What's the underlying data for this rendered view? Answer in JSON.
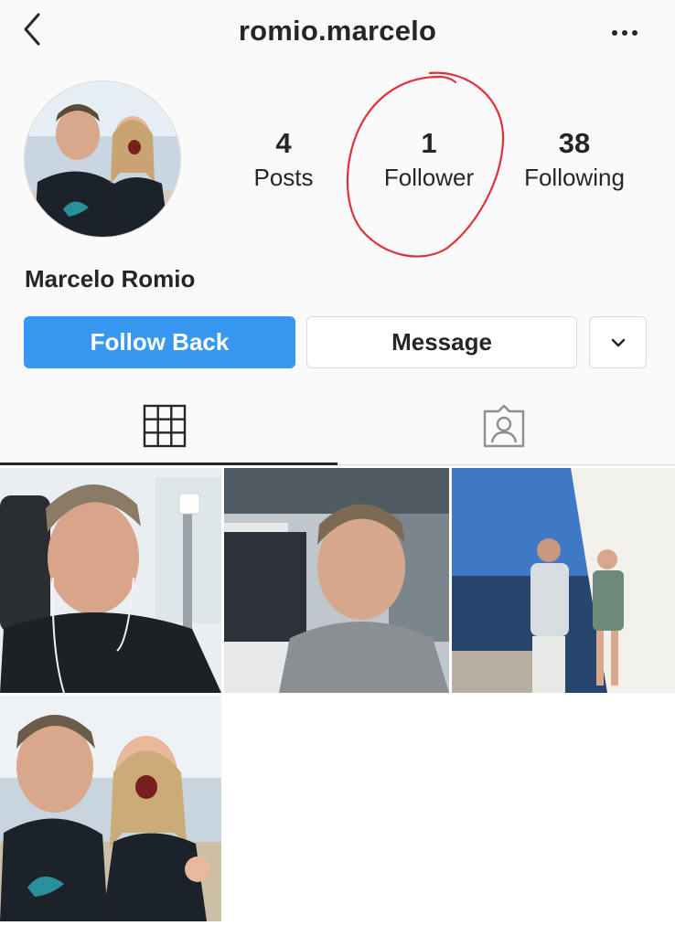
{
  "header": {
    "username": "romio.marcelo",
    "back_icon": "chevron-left-icon",
    "more_icon": "more-horizontal-icon"
  },
  "profile": {
    "full_name": "Marcelo Romio",
    "stats": [
      {
        "value": "4",
        "label": "Posts"
      },
      {
        "value": "1",
        "label": "Follower"
      },
      {
        "value": "38",
        "label": "Following"
      }
    ],
    "annotation_color": "#e0303a"
  },
  "actions": {
    "follow_back_label": "Follow Back",
    "message_label": "Message",
    "more_icon": "chevron-down-icon",
    "accent_color": "#3897f0"
  },
  "tabs": [
    {
      "icon": "grid-icon",
      "active": true
    },
    {
      "icon": "tagged-icon",
      "active": false
    }
  ],
  "posts": [
    {
      "subject": "gym-selfie"
    },
    {
      "subject": "gym-selfie"
    },
    {
      "subject": "seaside-photo"
    },
    {
      "subject": "selfie-with-girl"
    }
  ]
}
